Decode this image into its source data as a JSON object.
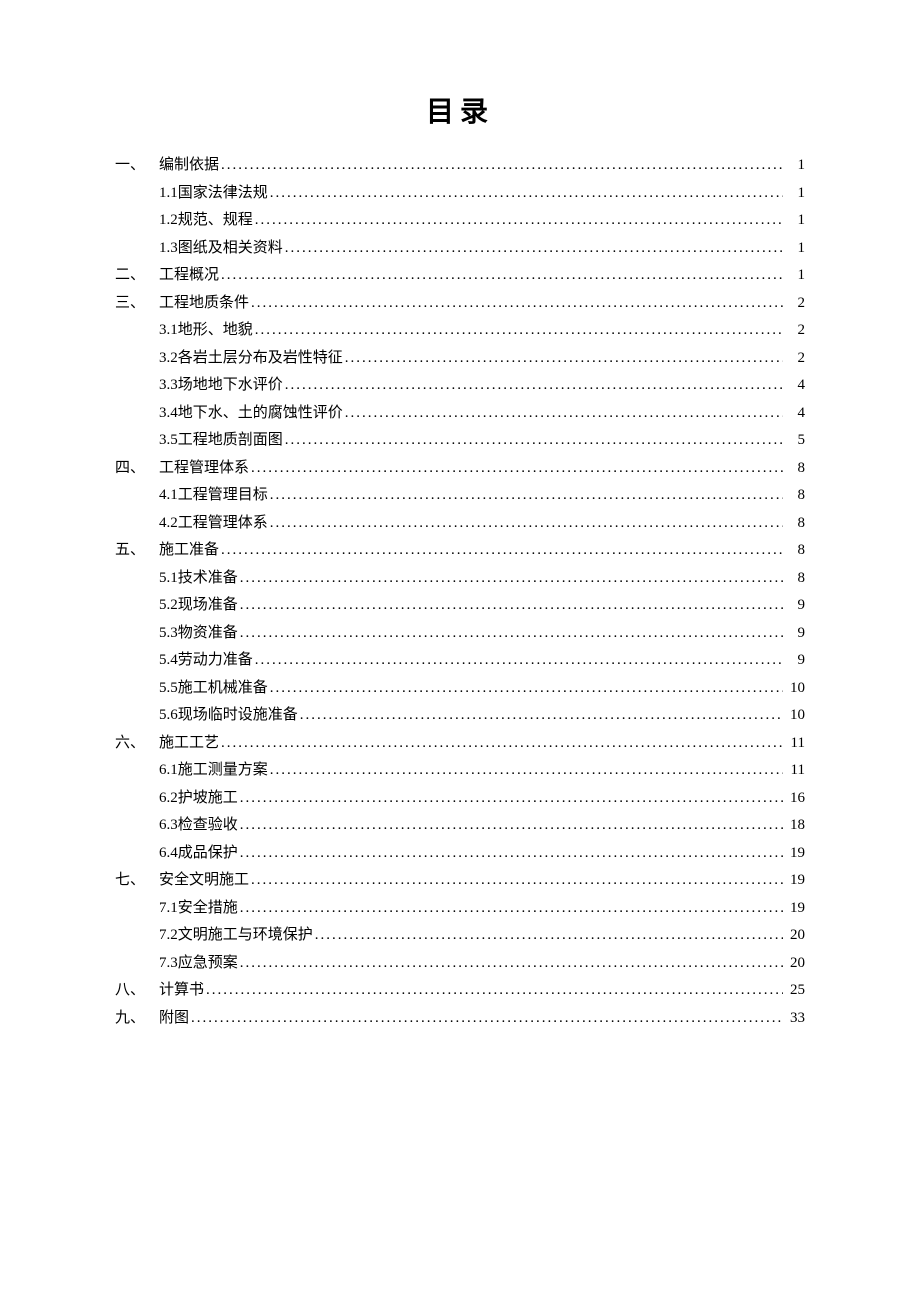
{
  "title": "目录",
  "entries": [
    {
      "level": 1,
      "num": "一、",
      "label": "编制依据",
      "page": "1"
    },
    {
      "level": 2,
      "num": "1.1",
      "label": "国家法律法规",
      "page": "1"
    },
    {
      "level": 2,
      "num": "1.2",
      "label": "规范、规程",
      "page": "1"
    },
    {
      "level": 2,
      "num": "1.3",
      "label": "图纸及相关资料",
      "page": "1"
    },
    {
      "level": 1,
      "num": "二、",
      "label": "工程概况",
      "page": "1"
    },
    {
      "level": 1,
      "num": "三、",
      "label": "工程地质条件",
      "page": "2"
    },
    {
      "level": 2,
      "num": "3.1",
      "label": "地形、地貌",
      "page": "2"
    },
    {
      "level": 2,
      "num": "3.2",
      "label": "各岩土层分布及岩性特征",
      "page": "2"
    },
    {
      "level": 2,
      "num": "3.3",
      "label": "场地地下水评价",
      "page": "4"
    },
    {
      "level": 2,
      "num": "3.4",
      "label": "地下水、土的腐蚀性评价",
      "page": "4"
    },
    {
      "level": 2,
      "num": "3.5",
      "label": "工程地质剖面图",
      "page": "5"
    },
    {
      "level": 1,
      "num": "四、",
      "label": "工程管理体系",
      "page": "8"
    },
    {
      "level": 2,
      "num": "4.1",
      "label": "工程管理目标",
      "page": "8"
    },
    {
      "level": 2,
      "num": "4.2",
      "label": "工程管理体系",
      "page": "8"
    },
    {
      "level": 1,
      "num": "五、",
      "label": "施工准备",
      "page": "8"
    },
    {
      "level": 2,
      "num": "5.1",
      "label": "技术准备",
      "page": "8"
    },
    {
      "level": 2,
      "num": "5.2",
      "label": "现场准备",
      "page": "9"
    },
    {
      "level": 2,
      "num": "5.3",
      "label": "物资准备",
      "page": "9"
    },
    {
      "level": 2,
      "num": "5.4",
      "label": "劳动力准备",
      "page": "9"
    },
    {
      "level": 2,
      "num": "5.5 ",
      "label": "施工机械准备",
      "page": "10"
    },
    {
      "level": 2,
      "num": "5.6",
      "label": "现场临时设施准备",
      "page": "10"
    },
    {
      "level": 1,
      "num": "六、",
      "label": "施工工艺",
      "page": "11"
    },
    {
      "level": 2,
      "num": "6.1",
      "label": "施工测量方案",
      "page": "11"
    },
    {
      "level": 2,
      "num": "6.2",
      "label": "护坡施工",
      "page": "16"
    },
    {
      "level": 2,
      "num": "6.3",
      "label": "检查验收",
      "page": "18"
    },
    {
      "level": 2,
      "num": "6.4",
      "label": "成品保护",
      "page": "19"
    },
    {
      "level": 1,
      "num": "七、",
      "label": "安全文明施工",
      "page": "19"
    },
    {
      "level": 2,
      "num": "7.1",
      "label": "安全措施",
      "page": "19"
    },
    {
      "level": 2,
      "num": "7.2",
      "label": "文明施工与环境保护",
      "page": "20"
    },
    {
      "level": 2,
      "num": "7.3",
      "label": "应急预案",
      "page": "20"
    },
    {
      "level": 1,
      "num": "八、",
      "label": "计算书",
      "page": "25"
    },
    {
      "level": 1,
      "num": "九、",
      "label": "附图",
      "page": "33"
    }
  ]
}
